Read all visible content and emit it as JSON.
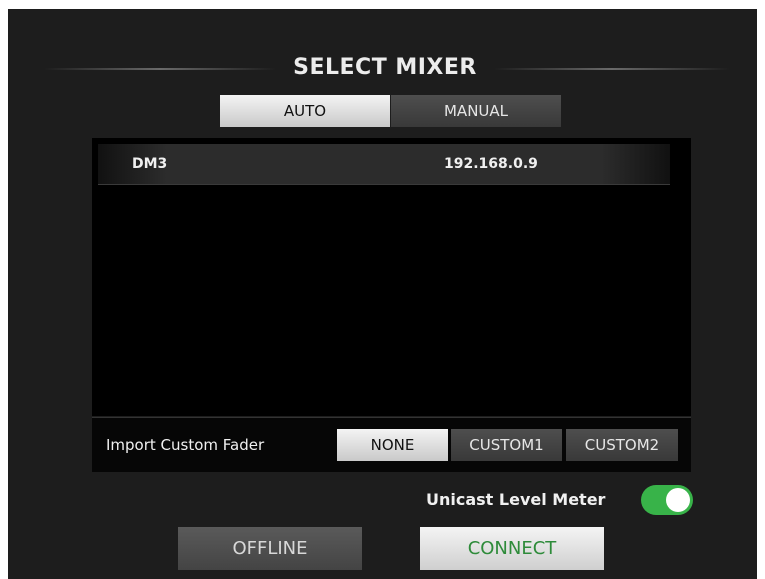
{
  "dialog": {
    "title": "SELECT MIXER"
  },
  "tabs": [
    {
      "label": "AUTO",
      "selected": true
    },
    {
      "label": "MANUAL",
      "selected": false
    }
  ],
  "mixers": [
    {
      "name": "DM3",
      "ip": "192.168.0.9"
    }
  ],
  "import_custom_fader": {
    "label": "Import Custom Fader",
    "options": [
      "NONE",
      "CUSTOM1",
      "CUSTOM2"
    ],
    "selected": "NONE"
  },
  "unicast_level_meter": {
    "label": "Unicast Level Meter",
    "enabled": true,
    "color": "#38b349"
  },
  "buttons": {
    "offline": "OFFLINE",
    "connect": "CONNECT"
  }
}
